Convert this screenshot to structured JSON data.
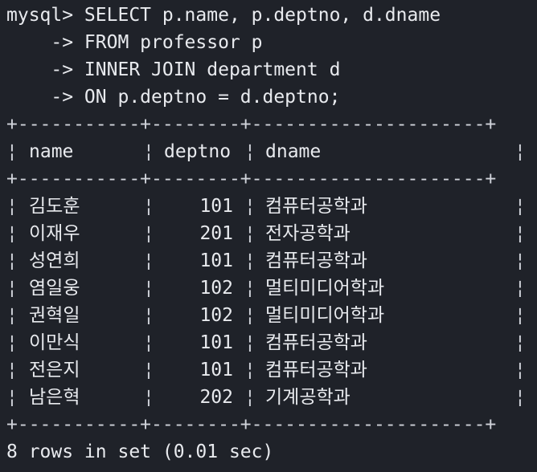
{
  "query": {
    "lines": [
      "mysql> SELECT p.name, p.deptno, d.dname",
      "    -> FROM professor p",
      "    -> INNER JOIN department d",
      "    -> ON p.deptno = d.deptno;"
    ]
  },
  "table": {
    "border": "+-----------+--------+---------------------+",
    "columns": [
      "name",
      "deptno",
      "dname"
    ],
    "rows": [
      {
        "name": "김도훈",
        "deptno": "101",
        "dname": "컴퓨터공학과"
      },
      {
        "name": "이재우",
        "deptno": "201",
        "dname": "전자공학과"
      },
      {
        "name": "성연희",
        "deptno": "101",
        "dname": "컴퓨터공학과"
      },
      {
        "name": "염일웅",
        "deptno": "102",
        "dname": "멀티미디어학과"
      },
      {
        "name": "권혁일",
        "deptno": "102",
        "dname": "멀티미디어학과"
      },
      {
        "name": "이만식",
        "deptno": "101",
        "dname": "컴퓨터공학과"
      },
      {
        "name": "전은지",
        "deptno": "101",
        "dname": "컴퓨터공학과"
      },
      {
        "name": "남은혁",
        "deptno": "202",
        "dname": "기계공학과"
      }
    ]
  },
  "footer": "8 rows in set (0.01 sec)",
  "colors": {
    "background": "#1f2229",
    "text": "#e8eaee"
  }
}
